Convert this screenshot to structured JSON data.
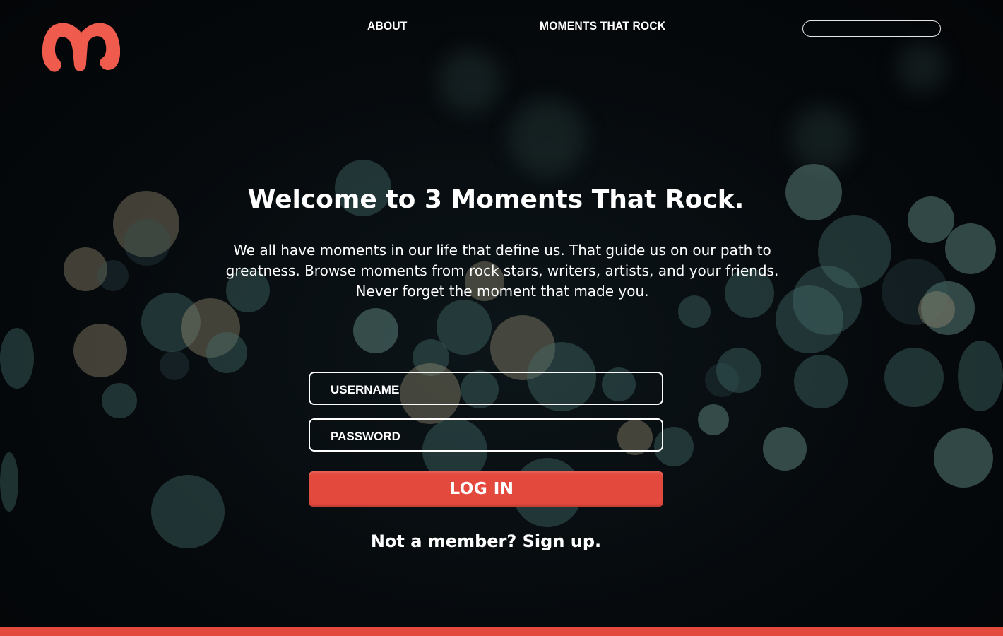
{
  "header": {
    "nav": {
      "about": "ABOUT",
      "moments": "MOMENTS THAT ROCK"
    },
    "search": {
      "value": "",
      "placeholder": ""
    }
  },
  "hero": {
    "title": "Welcome to 3 Moments That Rock.",
    "line1": "We all have moments in our life that define us. That guide us on our path to",
    "line2": "greatness. Browse moments from rock stars, writers, artists, and your friends.",
    "line3": "Never forget the moment that made you."
  },
  "login_form": {
    "username": {
      "placeholder": "USERNAME",
      "value": ""
    },
    "password": {
      "placeholder": "PASSWORD",
      "value": ""
    },
    "submit_label": "LOG IN",
    "signup_text": "Not a member? Sign up."
  },
  "colors": {
    "accent": "#e4493d",
    "background": "#05080b",
    "text": "#ffffff"
  },
  "icons": {
    "logo": "m-logo-icon"
  }
}
